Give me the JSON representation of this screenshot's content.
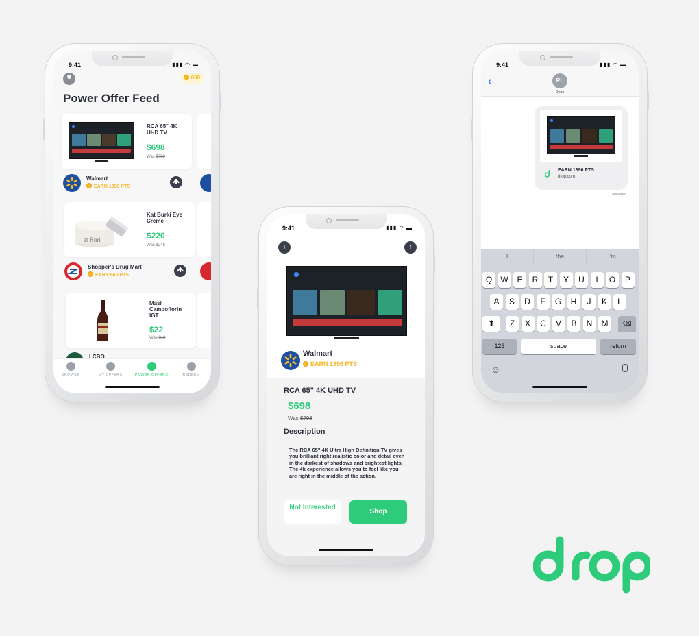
{
  "colors": {
    "accent": "#2ecc7a",
    "points": "#f5b928",
    "dark": "#3a3f4b",
    "link": "#2f7bf5"
  },
  "status_time": "9:41",
  "feed": {
    "points": "668",
    "title": "Power Offer Feed",
    "items": [
      {
        "product": "RCA 65\" 4K UHD TV",
        "price": "$698",
        "was_prefix": "Was ",
        "was_price": "$798",
        "store": "Walmart",
        "earn": "EARN 1396 PTS",
        "image": "tv-image"
      },
      {
        "product": "Kat Burki Eye Crème",
        "price": "$220",
        "was_prefix": "Was ",
        "was_price": "$248",
        "store": "Shopper's Drug Mart",
        "earn": "EARN 660 PTS",
        "image": "cream-jar-image"
      },
      {
        "product": "Masi Campofiorin IGT",
        "price": "$22",
        "was_prefix": "Was ",
        "was_price": "$19",
        "store": "LCBO",
        "earn": "",
        "image": "wine-bottle-image"
      }
    ],
    "tabs": [
      {
        "label": "BROWSE",
        "icon": "compass-icon"
      },
      {
        "label": "MY OFFERS",
        "icon": "tag-icon"
      },
      {
        "label": "POWER OFFERS",
        "icon": "drop-icon",
        "active": true
      },
      {
        "label": "REDEEM",
        "icon": "dollar-icon"
      }
    ]
  },
  "detail": {
    "store": "Walmart",
    "earn": "EARN 1396 PTS",
    "product": "RCA 65\" 4K UHD TV",
    "price": "$698",
    "was_prefix": "Was ",
    "was_price": "$798",
    "description_heading": "Description",
    "description": "The RCA 65\" 4K Ultra High Definition TV gives you brilliant right realistic color and detail even in the darkest of shadows and brightest lights. The 4k experience allows you to feel like you are right in the middle of the action.",
    "not_interested": "Not Interested",
    "shop": "Shop"
  },
  "messages": {
    "contact_initials": "RL",
    "contact_name": "Ryan",
    "card_earn": "EARN 1396 PTS",
    "card_site": "drop.com",
    "delivered": "Delivered",
    "suggestions": [
      "I",
      "the",
      "I'm"
    ],
    "rows": [
      [
        "Q",
        "W",
        "E",
        "R",
        "T",
        "Y",
        "U",
        "I",
        "O",
        "P"
      ],
      [
        "A",
        "S",
        "D",
        "F",
        "G",
        "H",
        "J",
        "K",
        "L"
      ],
      [
        "Z",
        "X",
        "C",
        "V",
        "B",
        "N",
        "M"
      ]
    ],
    "key_123": "123",
    "key_space": "space",
    "key_return": "return"
  },
  "brand": {
    "logo_text": "drop"
  }
}
